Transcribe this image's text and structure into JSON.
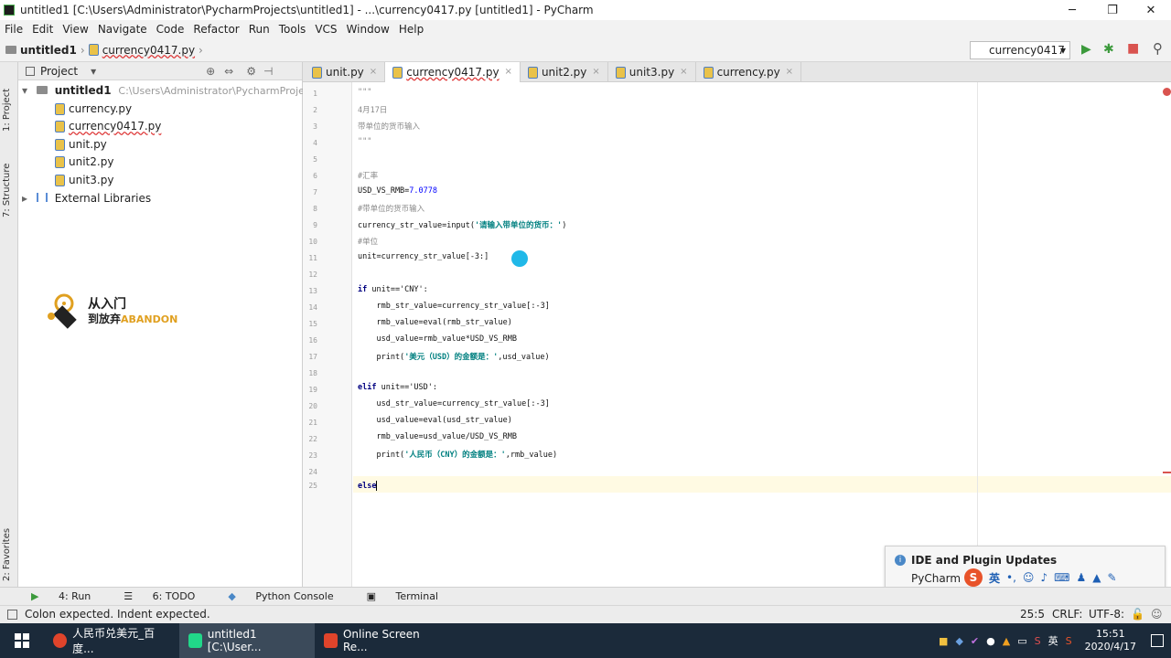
{
  "window": {
    "title": "untitled1 [C:\\Users\\Administrator\\PycharmProjects\\untitled1] - ...\\currency0417.py [untitled1] - PyCharm",
    "minimize": "─",
    "maximize": "❐",
    "close": "✕"
  },
  "menu": [
    "File",
    "Edit",
    "View",
    "Navigate",
    "Code",
    "Refactor",
    "Run",
    "Tools",
    "VCS",
    "Window",
    "Help"
  ],
  "breadcrumb": {
    "project": "untitled1",
    "file": "currency0417.py"
  },
  "run_config": {
    "name": "currency0417",
    "arrow": "▾"
  },
  "toolbar_icons": {
    "run": "▶",
    "debug": "✱",
    "stop": "■",
    "search": "⚲"
  },
  "left_strip": {
    "project": "1: Project",
    "structure": "7: Structure",
    "favorites": "2: Favorites"
  },
  "project_panel": {
    "title": "Project",
    "root": "untitled1",
    "root_path": "C:\\Users\\Administrator\\PycharmProjects\\untitled1",
    "files": [
      "currency.py",
      "currency0417.py",
      "unit.py",
      "unit2.py",
      "unit3.py"
    ],
    "external": "External Libraries"
  },
  "tabs": [
    {
      "label": "unit.py"
    },
    {
      "label": "currency0417.py"
    },
    {
      "label": "unit2.py"
    },
    {
      "label": "unit3.py"
    },
    {
      "label": "currency.py"
    }
  ],
  "tab_close": "×",
  "line_numbers": [
    "1",
    "2",
    "3",
    "4",
    "5",
    "6",
    "7",
    "8",
    "9",
    "10",
    "11",
    "12",
    "13",
    "14",
    "15",
    "16",
    "17",
    "18",
    "19",
    "20",
    "21",
    "22",
    "23",
    "24",
    "25"
  ],
  "code": {
    "l1": "\"\"\"",
    "l2": "4月17日",
    "l3": "带单位的货币输入",
    "l4": "\"\"\"",
    "l6": "#汇率",
    "l7a": "USD_VS_RMB=",
    "l7b": "7.0778",
    "l8": "#带单位的货币输入",
    "l9a": "currency_str_value=input(",
    "l9b": "'请输入带单位的货币：'",
    "l9c": ")",
    "l10": "#单位",
    "l11": "unit=currency_str_value[-3:]",
    "l13a": "if ",
    "l13b": "unit=='CNY':",
    "l14": "    rmb_str_value=currency_str_value[:-3]",
    "l15": "    rmb_value=eval(rmb_str_value)",
    "l16": "    usd_value=rmb_value*USD_VS_RMB",
    "l17a": "    print(",
    "l17b": "'美元（USD）的金额是：'",
    "l17c": ",usd_value)",
    "l19a": "elif ",
    "l19b": "unit=='USD':",
    "l20": "    usd_str_value=currency_str_value[:-3]",
    "l21": "    usd_value=eval(usd_str_value)",
    "l22": "    rmb_value=usd_value/USD_VS_RMB",
    "l23a": "    print(",
    "l23b": "'人民币（CNY）的金额是：'",
    "l23c": ",rmb_value)",
    "l25": "else"
  },
  "watermark": {
    "line1": "从入门",
    "line2": "到放弃",
    "brand": "ABANDON"
  },
  "bottom_tools": [
    "4: Run",
    "6: TODO",
    "Python Console",
    "Terminal"
  ],
  "status": {
    "message": "Colon expected. Indent expected.",
    "position": "25:5",
    "line_sep": "CRLF:",
    "encoding": "UTF-8:"
  },
  "popup": {
    "title": "IDE and Plugin Updates",
    "body": "PyCharm i"
  },
  "ime": {
    "label": "英"
  },
  "taskbar": {
    "items": [
      "人民币兑美元_百度...",
      "untitled1 [C:\\User...",
      "Online Screen Re..."
    ],
    "tray_ime": "英",
    "time": "15:51",
    "date": "2020/4/17"
  },
  "colors": {
    "accent": "#4a88c7",
    "run_green": "#3c9a3c",
    "stop_red": "#d9534f",
    "string_teal": "#008080"
  }
}
